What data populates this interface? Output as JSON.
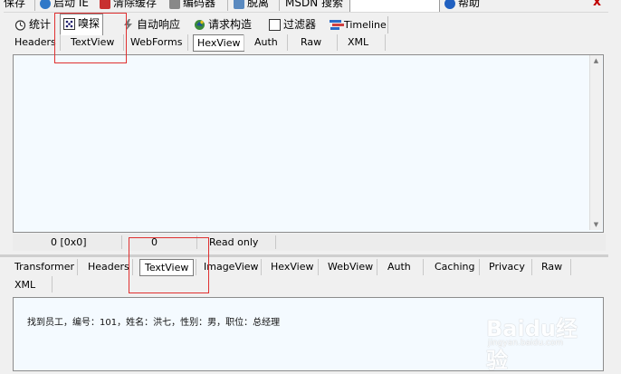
{
  "toolbar": {
    "items": [
      {
        "label": "保存",
        "icon": "save-icon"
      },
      {
        "label": "启动 IE",
        "icon": "ie-icon"
      },
      {
        "label": "清除缓存",
        "icon": "clear-cache-icon"
      },
      {
        "label": "编码器",
        "icon": "encoder-icon"
      },
      {
        "label": "脱离",
        "icon": "tearoff-icon"
      }
    ],
    "msdn_label": "MSDN 搜索",
    "msdn_value": "",
    "help_label": "帮助",
    "close_glyph": "x"
  },
  "main_tabs": [
    {
      "label": "统计",
      "icon": "stopwatch-icon",
      "selected": false
    },
    {
      "label": "嗅探",
      "icon": "inspector-icon",
      "selected": true
    },
    {
      "label": "自动响应",
      "icon": "lightning-icon",
      "selected": false
    },
    {
      "label": "请求构造",
      "icon": "composer-icon",
      "selected": false
    },
    {
      "label": "过滤器",
      "icon": "checkbox-icon",
      "selected": false
    },
    {
      "label": "Timeline",
      "icon": "timeline-icon",
      "selected": false
    }
  ],
  "request_tabs": [
    "Headers",
    "TextView",
    "WebForms",
    "HexView",
    "Auth",
    "Raw",
    "XML"
  ],
  "request_selected": "HexView",
  "status": {
    "offset": "0 [0x0]",
    "count": "0",
    "mode": "Read only"
  },
  "response_tabs_row1": [
    "Transformer",
    "Headers",
    "TextView",
    "ImageView",
    "HexView",
    "WebView",
    "Auth",
    "Caching",
    "Privacy",
    "Raw"
  ],
  "response_tabs_row2": [
    "XML"
  ],
  "response_selected": "TextView",
  "response_text": "找到员工，编号：101，姓名：洪七，性别：男，职位：总经理",
  "watermark": {
    "brand": "Baidu经验",
    "url": "jingyan.baidu.com"
  },
  "colors": {
    "pane_bg": "#f4faff",
    "chrome_bg": "#f0f0f0",
    "highlight": "#e03030"
  }
}
